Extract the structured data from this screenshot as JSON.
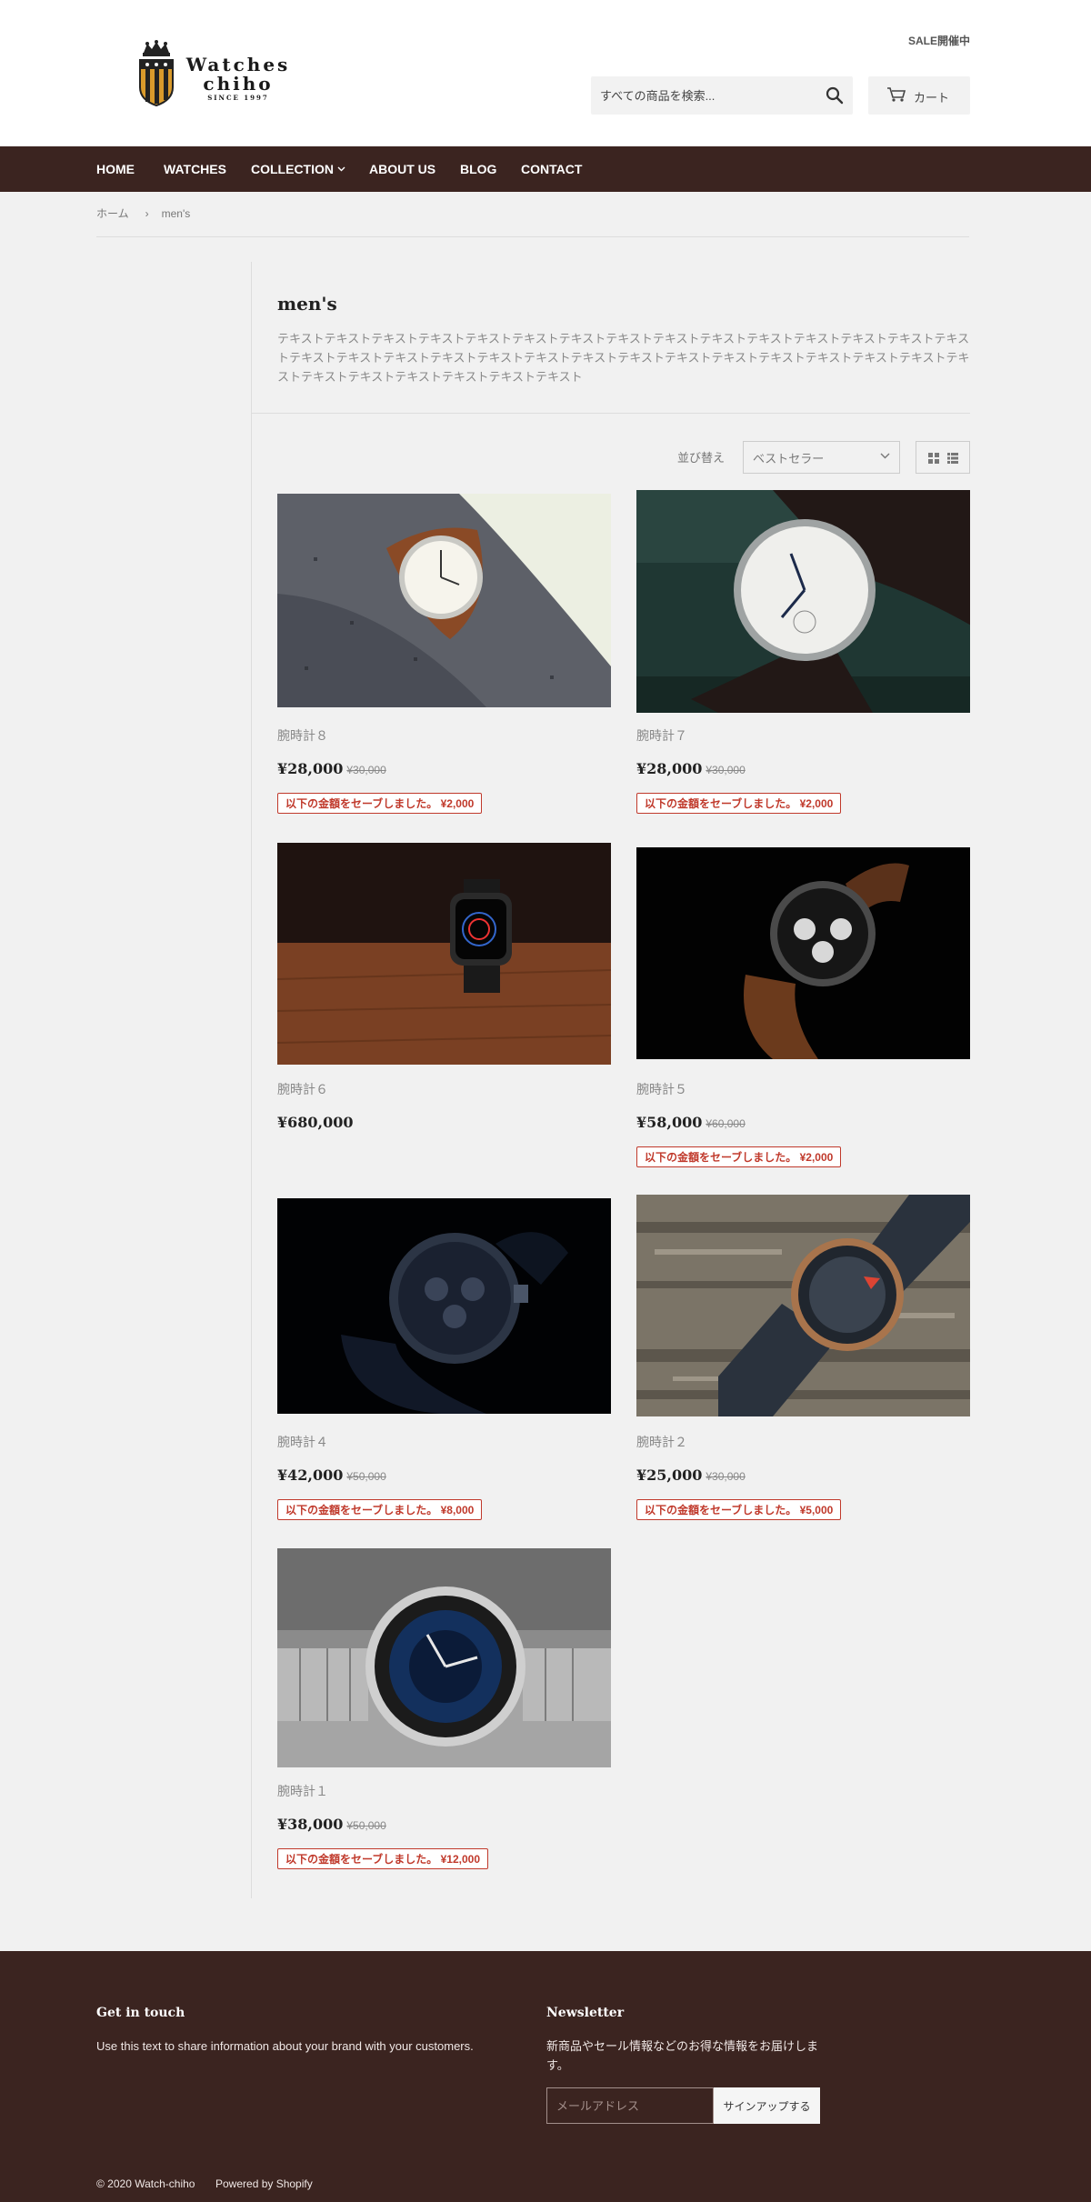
{
  "header": {
    "logo": {
      "line1": "Watches",
      "line2": "chiho",
      "line3": "SINCE 1997"
    },
    "announcement": "SALE開催中",
    "search_placeholder": "すべての商品を検索...",
    "cart_label": "カート"
  },
  "nav": {
    "items": [
      {
        "label": "HOME"
      },
      {
        "label": "WATCHES"
      },
      {
        "label": "COLLECTION"
      },
      {
        "label": "ABOUT US"
      },
      {
        "label": "BLOG"
      },
      {
        "label": "CONTACT"
      }
    ]
  },
  "breadcrumb": {
    "home": "ホーム",
    "separator": "›",
    "current": "men's"
  },
  "collection": {
    "title": "men's",
    "description": "テキストテキストテキストテキストテキストテキストテキストテキストテキストテキストテキストテキストテキストテキストテキストテキストテキストテキストテキストテキストテキストテキストテキストテキストテキストテキストテキストテキストテキストテキストテキストテキストテキストテキストテキストテキスト",
    "sort_label": "並び替え",
    "sort_value": "ベストセラー"
  },
  "products": [
    {
      "name": "腕時計８",
      "price": "¥28,000",
      "compare": "¥30,000",
      "save": "以下の金額をセーブしました。 ¥2,000"
    },
    {
      "name": "腕時計７",
      "price": "¥28,000",
      "compare": "¥30,000",
      "save": "以下の金額をセーブしました。 ¥2,000"
    },
    {
      "name": "腕時計６",
      "price": "¥680,000",
      "compare": "",
      "save": ""
    },
    {
      "name": "腕時計５",
      "price": "¥58,000",
      "compare": "¥60,000",
      "save": "以下の金額をセーブしました。 ¥2,000"
    },
    {
      "name": "腕時計４",
      "price": "¥42,000",
      "compare": "¥50,000",
      "save": "以下の金額をセーブしました。 ¥8,000"
    },
    {
      "name": "腕時計２",
      "price": "¥25,000",
      "compare": "¥30,000",
      "save": "以下の金額をセーブしました。 ¥5,000"
    },
    {
      "name": "腕時計１",
      "price": "¥38,000",
      "compare": "¥50,000",
      "save": "以下の金額をセーブしました。 ¥12,000"
    }
  ],
  "footer": {
    "contact_heading": "Get in touch",
    "contact_text": "Use this text to share information about your brand with your customers.",
    "newsletter_heading": "Newsletter",
    "newsletter_text": "新商品やセール情報などのお得な情報をお届けします。",
    "email_placeholder": "メールアドレス",
    "signup_label": "サインアップする",
    "copyright": "© 2020 Watch-chiho",
    "powered": "Powered by Shopify"
  },
  "colors": {
    "nav_bg": "#3b2420",
    "footer_bg": "#3b2420",
    "sale_red": "#c0392b",
    "page_bg": "#f1f1f1"
  }
}
